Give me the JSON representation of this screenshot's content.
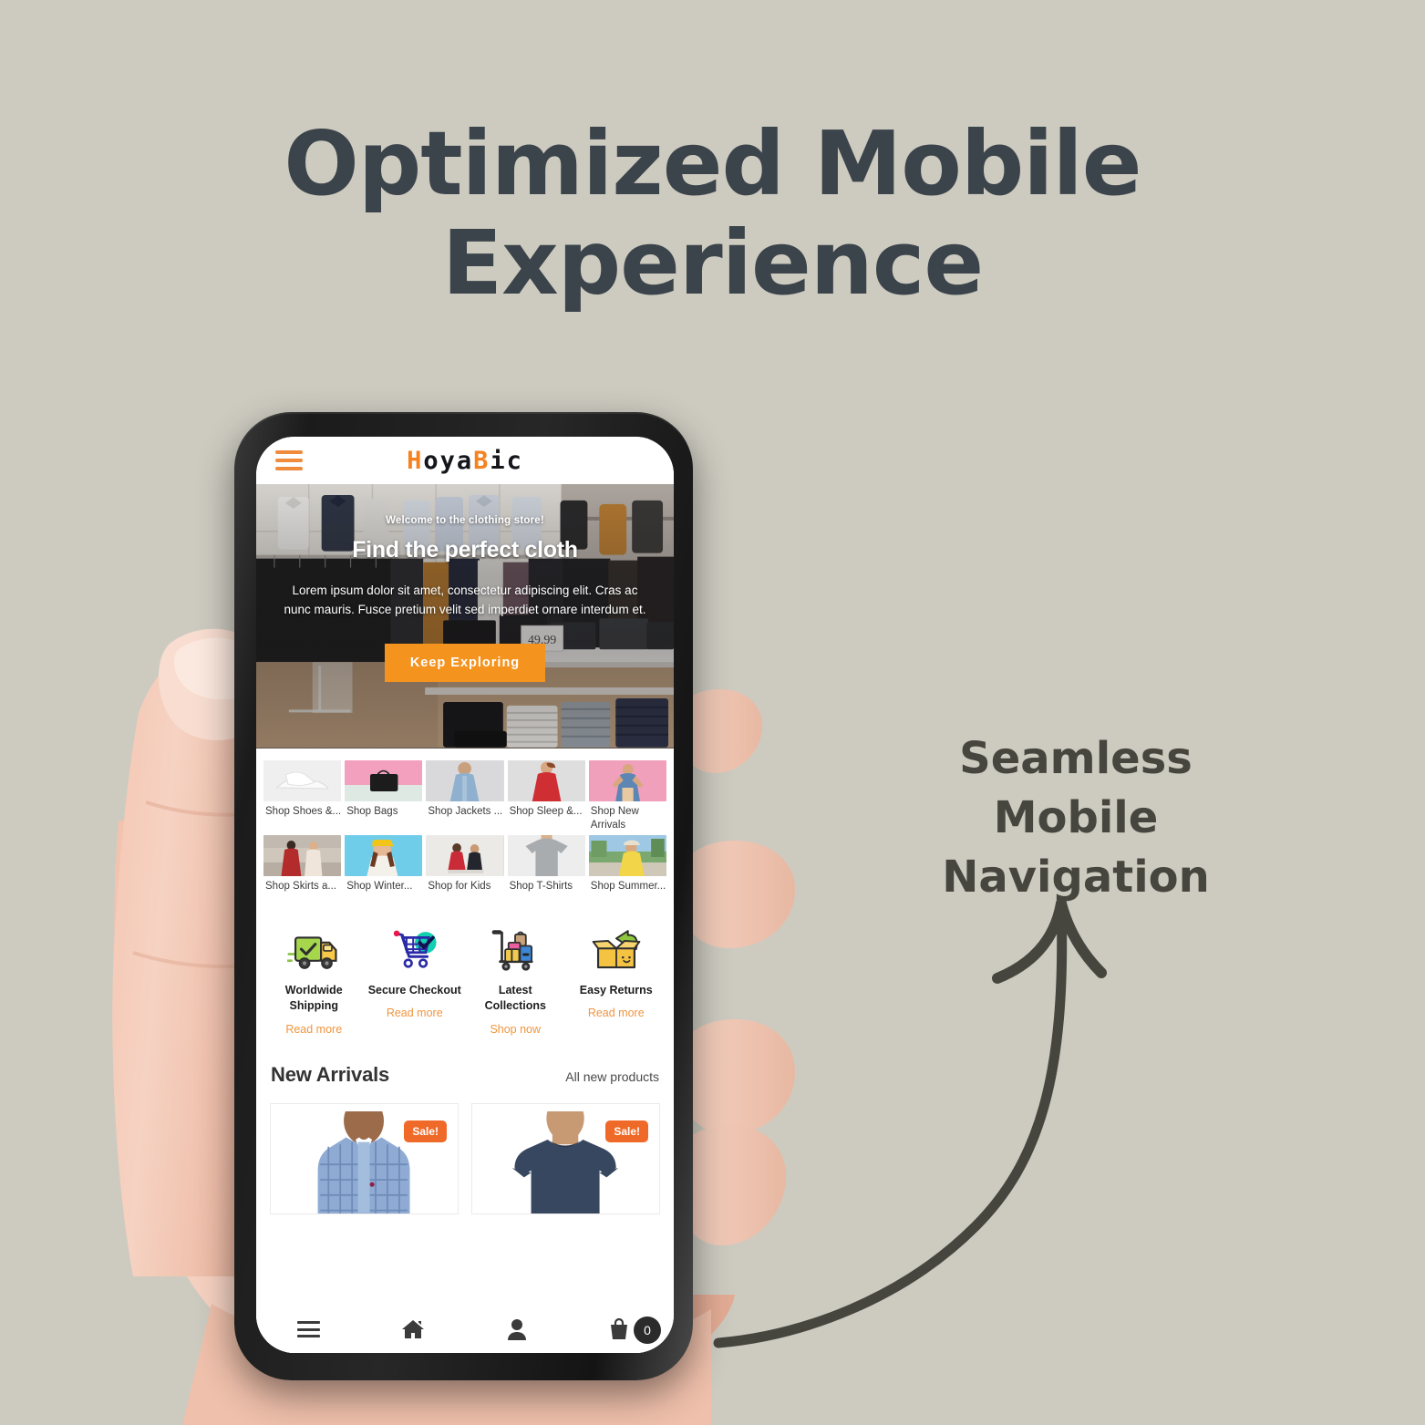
{
  "poster": {
    "background_color": "#cdcbc0",
    "headline_line1": "Optimized Mobile",
    "headline_line2": "Experience",
    "headline_color": "#3c444b",
    "annotation_line1": "Seamless Mobile",
    "annotation_line2": "Navigation",
    "annotation_color": "#46463f",
    "arrow_name": "curved-arrow-pointing-up"
  },
  "app": {
    "header": {
      "menu_icon": "hamburger-icon",
      "menu_icon_color": "#f08b3c",
      "logo_part1": "H",
      "logo_part2": "oya",
      "logo_part3": "B",
      "logo_part4": "ic",
      "logo_accent_color": "#f5821f",
      "logo_dark_color": "#15161a"
    },
    "hero": {
      "kicker": "Welcome to the clothing store!",
      "title": "Find the perfect cloth",
      "subtitle": "Lorem ipsum dolor sit amet, consectetur adipiscing elit. Cras ac nunc mauris. Fusce pretium velit sed imperdiet ornare interdum et.",
      "button_label": "Keep Exploring",
      "button_color": "#f5931f",
      "image_alt": "clothing-store-interior",
      "price_tag": "49.99"
    },
    "categories": [
      {
        "label": "Shop Shoes &...",
        "image": "white-sneakers"
      },
      {
        "label": "Shop Bags",
        "image": "black-handbag-pink-bg"
      },
      {
        "label": "Shop Jackets ...",
        "image": "woman-denim-jacket"
      },
      {
        "label": "Shop Sleep &...",
        "image": "woman-red-robe"
      },
      {
        "label": "Shop New Arrivals",
        "image": "woman-pink-bg"
      },
      {
        "label": "Shop Skirts a...",
        "image": "two-women-street"
      },
      {
        "label": "Shop Winter...",
        "image": "woman-yellow-beanie-blue-bg"
      },
      {
        "label": "Shop for Kids",
        "image": "two-children"
      },
      {
        "label": "Shop T-Shirts",
        "image": "grey-tshirt"
      },
      {
        "label": "Shop Summer...",
        "image": "woman-yellow-dress-outdoors"
      }
    ],
    "features": [
      {
        "icon": "delivery-truck-icon",
        "title": "Worldwide Shipping",
        "link": "Read more"
      },
      {
        "icon": "secure-cart-check-icon",
        "title": "Secure Checkout",
        "link": "Read more"
      },
      {
        "icon": "luggage-cart-icon",
        "title": "Latest Collections",
        "link": "Shop now"
      },
      {
        "icon": "open-box-return-icon",
        "title": "Easy Returns",
        "link": "Read more"
      }
    ],
    "feature_link_color": "#f0953f",
    "new_arrivals": {
      "title": "New Arrivals",
      "link": "All new products",
      "products": [
        {
          "badge": "Sale!",
          "image": "man-blue-plaid-shirt"
        },
        {
          "badge": "Sale!",
          "image": "man-navy-tshirt"
        }
      ],
      "badge_color": "#ef6a28"
    },
    "bottom_nav": [
      {
        "icon": "hamburger-icon",
        "label": "Menu"
      },
      {
        "icon": "home-icon",
        "label": "Home"
      },
      {
        "icon": "person-icon",
        "label": "Account"
      },
      {
        "icon": "shopping-bag-icon",
        "label": "Cart",
        "badge": "0"
      }
    ]
  }
}
